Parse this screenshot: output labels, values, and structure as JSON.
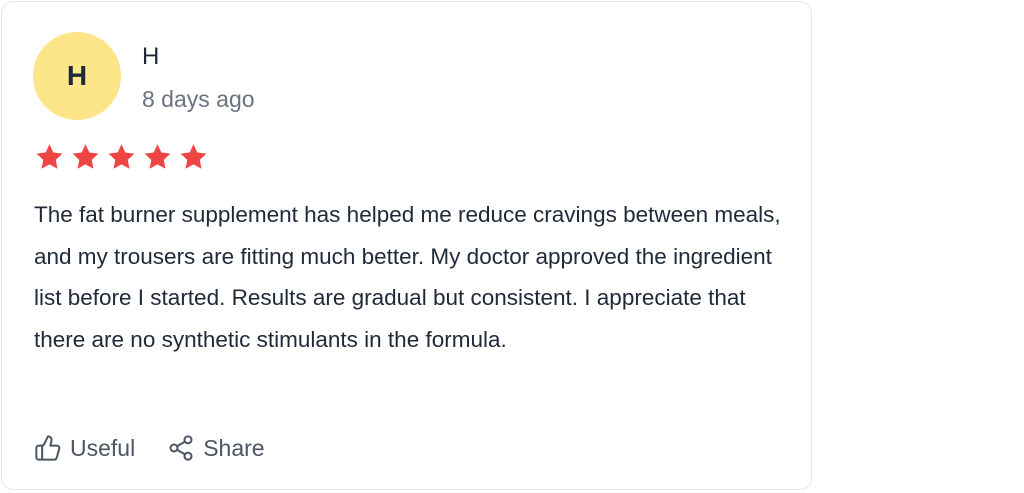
{
  "review": {
    "avatar_initial": "H",
    "avatar_color": "#fde68a",
    "author": "H",
    "date": "8 days ago",
    "rating": 5,
    "max_rating": 5,
    "star_color": "#ef4444",
    "text": "The fat burner supplement has helped me reduce cravings between meals, and my trousers are fitting much better. My doctor approved the ingredient list before I started. Results are gradual but consistent. I appreciate that there are no synthetic stimulants in the formula."
  },
  "actions": {
    "useful_label": "Useful",
    "useful_icon": "thumbs-up-icon",
    "share_label": "Share",
    "share_icon": "share-icon"
  }
}
